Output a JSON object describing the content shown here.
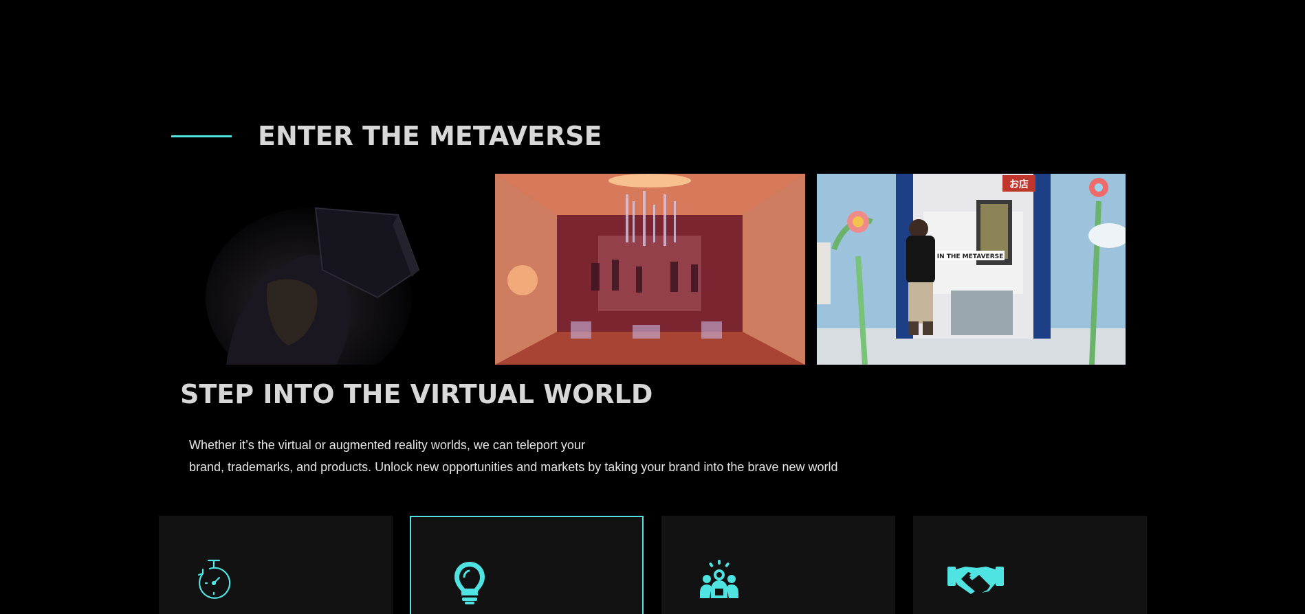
{
  "section": {
    "title": "ENTER THE METAVERSE"
  },
  "gallery": {
    "images": [
      {
        "name": "vr-headset-image",
        "description_icon": "vr-headset"
      },
      {
        "name": "virtual-hall-image",
        "description_icon": "virtual-hall"
      },
      {
        "name": "metaverse-store-image",
        "description_icon": "metaverse-avatar",
        "store_sign": "IN THE METAVERSE",
        "shop_sign": "お店"
      }
    ]
  },
  "main": {
    "heading": "STEP INTO THE VIRTUAL WORLD",
    "body_line_1": "Whether it’s the virtual or augmented reality worlds, we can teleport your",
    "body_line_2": "brand, trademarks, and products. Unlock new opportunities and markets by taking your brand into the brave new world"
  },
  "cards": [
    {
      "icon": "stopwatch-icon",
      "active": false
    },
    {
      "icon": "lightbulb-icon",
      "active": true
    },
    {
      "icon": "team-icon",
      "active": false
    },
    {
      "icon": "handshake-icon",
      "active": false
    }
  ],
  "colors": {
    "accent": "#4fe3e1",
    "background": "#000000",
    "card": "#121212",
    "heading": "#d8d8d8"
  }
}
